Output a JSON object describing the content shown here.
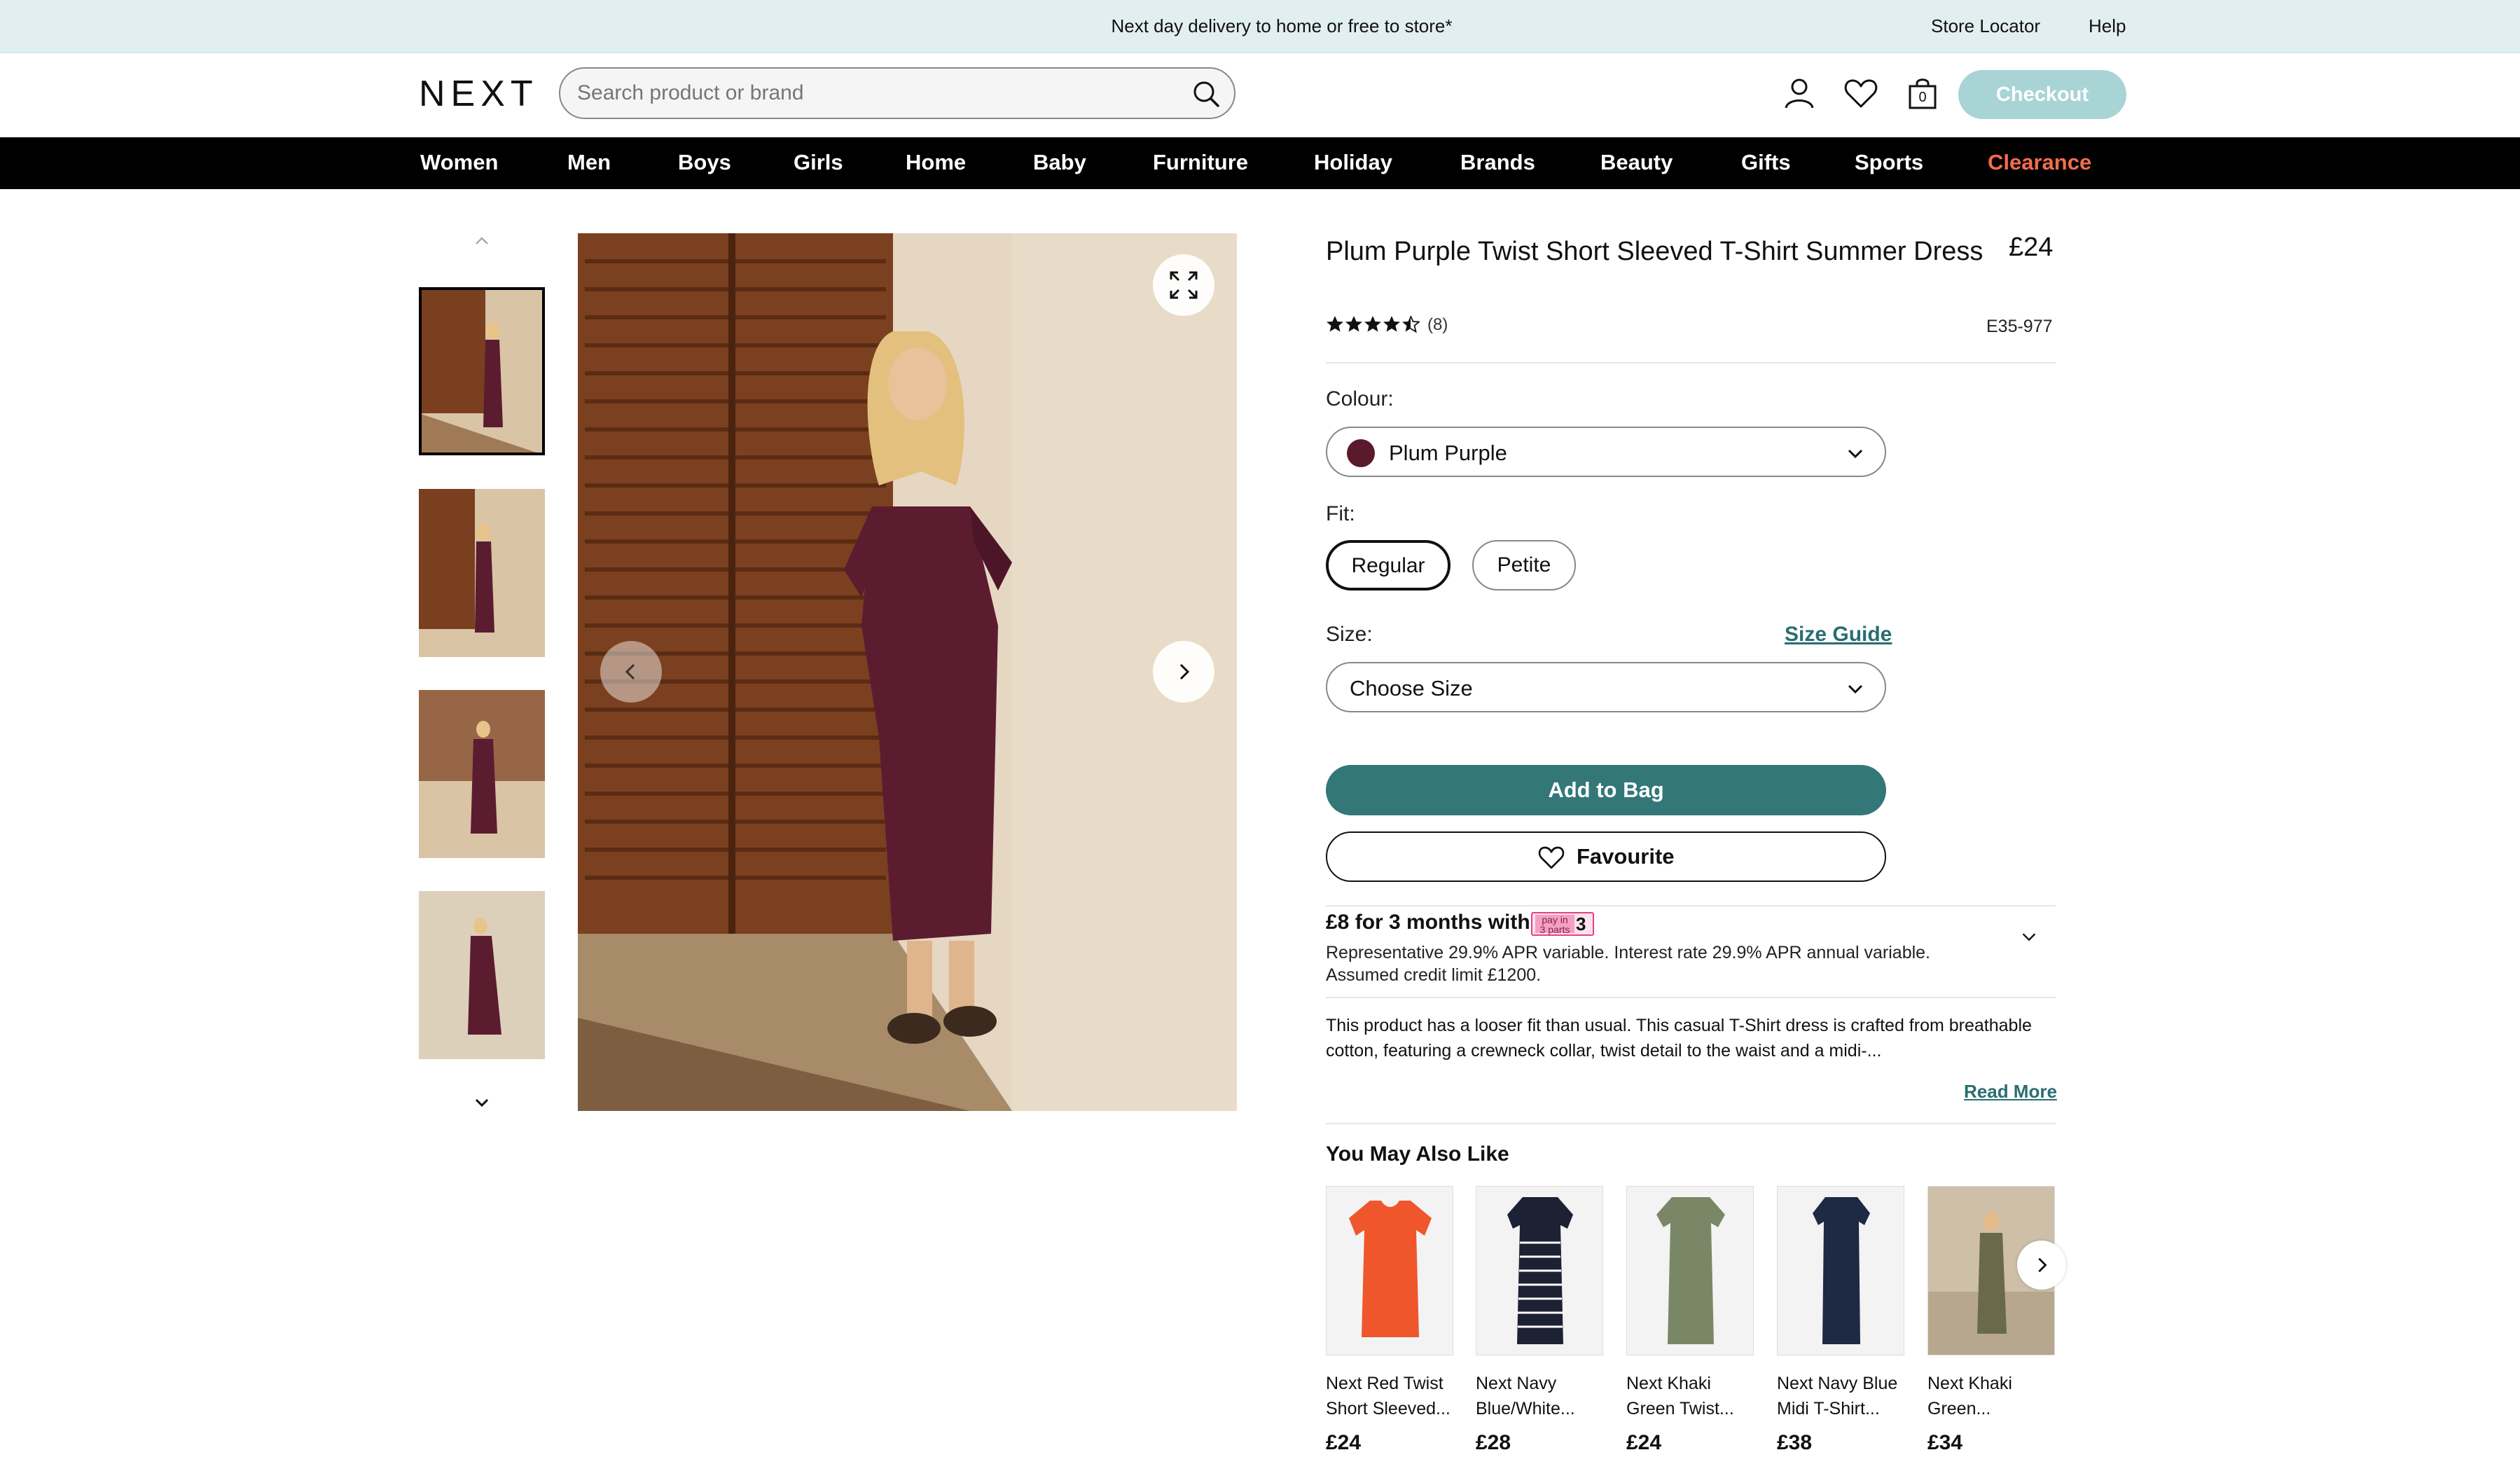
{
  "topbar": {
    "message": "Next day delivery to home or free to store*",
    "store_locator": "Store Locator",
    "help": "Help"
  },
  "header": {
    "logo": "NEXT",
    "search_placeholder": "Search product or brand",
    "bag_count": "0",
    "checkout": "Checkout"
  },
  "nav": [
    {
      "label": "Women"
    },
    {
      "label": "Men"
    },
    {
      "label": "Boys"
    },
    {
      "label": "Girls"
    },
    {
      "label": "Home"
    },
    {
      "label": "Baby"
    },
    {
      "label": "Furniture"
    },
    {
      "label": "Holiday"
    },
    {
      "label": "Brands"
    },
    {
      "label": "Beauty"
    },
    {
      "label": "Gifts"
    },
    {
      "label": "Sports"
    },
    {
      "label": "Clearance",
      "color": "#f26d4f"
    }
  ],
  "product": {
    "title": "Plum Purple Twist Short Sleeved T-Shirt Summer Dress",
    "price": "£24",
    "rating": 4.5,
    "reviews": "(8)",
    "code": "E35-977",
    "colour_label": "Colour:",
    "colour_value": "Plum Purple",
    "colour_swatch": "#5a1a2c",
    "fit_label": "Fit:",
    "fit_options": [
      "Regular",
      "Petite"
    ],
    "fit_selected": "Regular",
    "size_label": "Size:",
    "size_guide": "Size Guide",
    "size_value": "Choose Size",
    "add_to_bag": "Add to Bag",
    "favourite": "Favourite",
    "pay_line": "£8 for 3 months with",
    "pay_badge_number": "3",
    "apr_text": "Representative 29.9% APR variable. Interest rate 29.9% APR annual variable. Assumed credit limit £1200.",
    "description": "This product has a looser fit than usual. This casual T-Shirt dress is crafted from breathable cotton, featuring a crewneck collar, twist detail to the waist and a midi-...",
    "read_more": "Read More"
  },
  "recommendations": {
    "title": "You May Also Like",
    "items": [
      {
        "name": "Next Red Twist Short Sleeved...",
        "price": "£24",
        "color": "#f0562b"
      },
      {
        "name": "Next Navy Blue/White...",
        "price": "£28",
        "color": "#1c2233"
      },
      {
        "name": "Next Khaki Green Twist...",
        "price": "£24",
        "color": "#7a8766"
      },
      {
        "name": "Next Navy Blue Midi T-Shirt...",
        "price": "£38",
        "color": "#1e2a44"
      },
      {
        "name": "Next Khaki Green...",
        "price": "£34",
        "color": "#6a6a4a"
      }
    ]
  },
  "colors": {
    "accent": "#337779",
    "topbar_bg": "#e1eff0",
    "checkout_bg": "#a8d4d6",
    "clearance": "#f26d4f",
    "dress": "#5c1c30"
  }
}
